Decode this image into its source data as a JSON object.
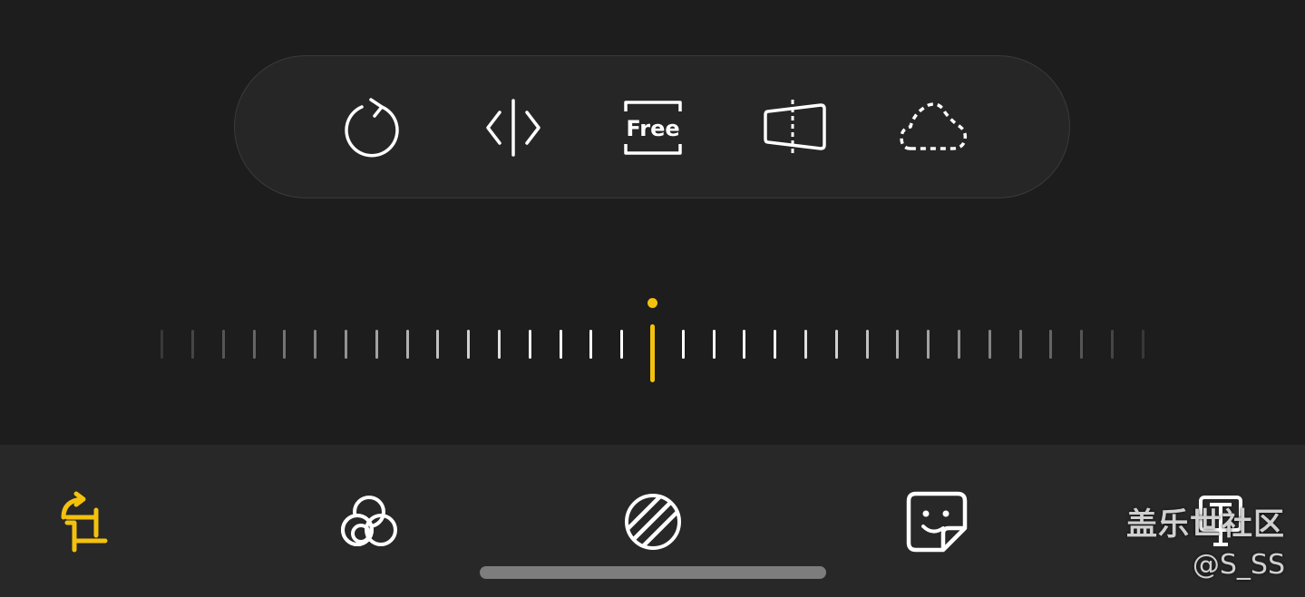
{
  "crop_tools": {
    "items": [
      {
        "name": "rotate",
        "icon": "rotate-icon"
      },
      {
        "name": "flip",
        "icon": "flip-icon"
      },
      {
        "name": "aspect-ratio",
        "icon": "aspect-ratio-icon",
        "label": "Free"
      },
      {
        "name": "perspective",
        "icon": "perspective-icon"
      },
      {
        "name": "lasso",
        "icon": "lasso-icon"
      }
    ]
  },
  "straighten_ruler": {
    "accent_color": "#f4c20d",
    "value": 0
  },
  "bottom_nav": {
    "active_color": "#f4c20d",
    "items": [
      {
        "name": "transform",
        "icon": "crop-rotate-icon",
        "active": true
      },
      {
        "name": "filters",
        "icon": "filters-icon",
        "active": false
      },
      {
        "name": "tone",
        "icon": "tone-icon",
        "active": false
      },
      {
        "name": "decorations",
        "icon": "sticker-icon",
        "active": false
      },
      {
        "name": "more",
        "icon": "more-tools-icon",
        "active": false
      }
    ]
  },
  "watermark": {
    "title": "盖乐世社区",
    "user": "@S_SS"
  }
}
